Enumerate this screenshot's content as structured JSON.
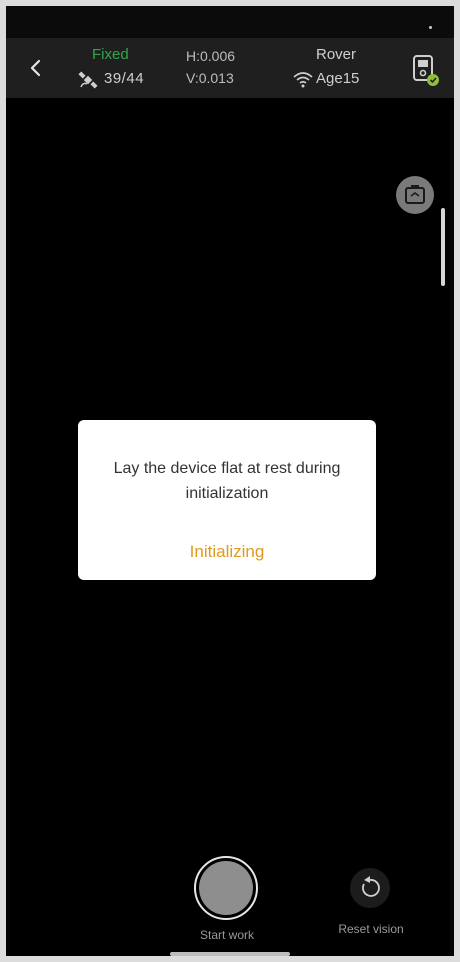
{
  "header": {
    "fix_status": "Fixed",
    "satellites": "39/44",
    "h_precision": "H:0.006",
    "v_precision": "V:0.013",
    "mode": "Rover",
    "age": "Age15"
  },
  "icons": {
    "back": "chevron-left-icon",
    "satellite": "satellite-icon",
    "wifi": "wifi-icon",
    "device": "device-icon",
    "camera_switch": "camera-switch-icon",
    "reset": "reset-icon"
  },
  "dialog": {
    "message": "Lay the device flat at rest during initialization",
    "status": "Initializing"
  },
  "controls": {
    "start_label": "Start work",
    "reset_label": "Reset vision"
  },
  "colors": {
    "fixed": "#2fa84a",
    "initializing": "#e09a20",
    "background": "#000000"
  }
}
